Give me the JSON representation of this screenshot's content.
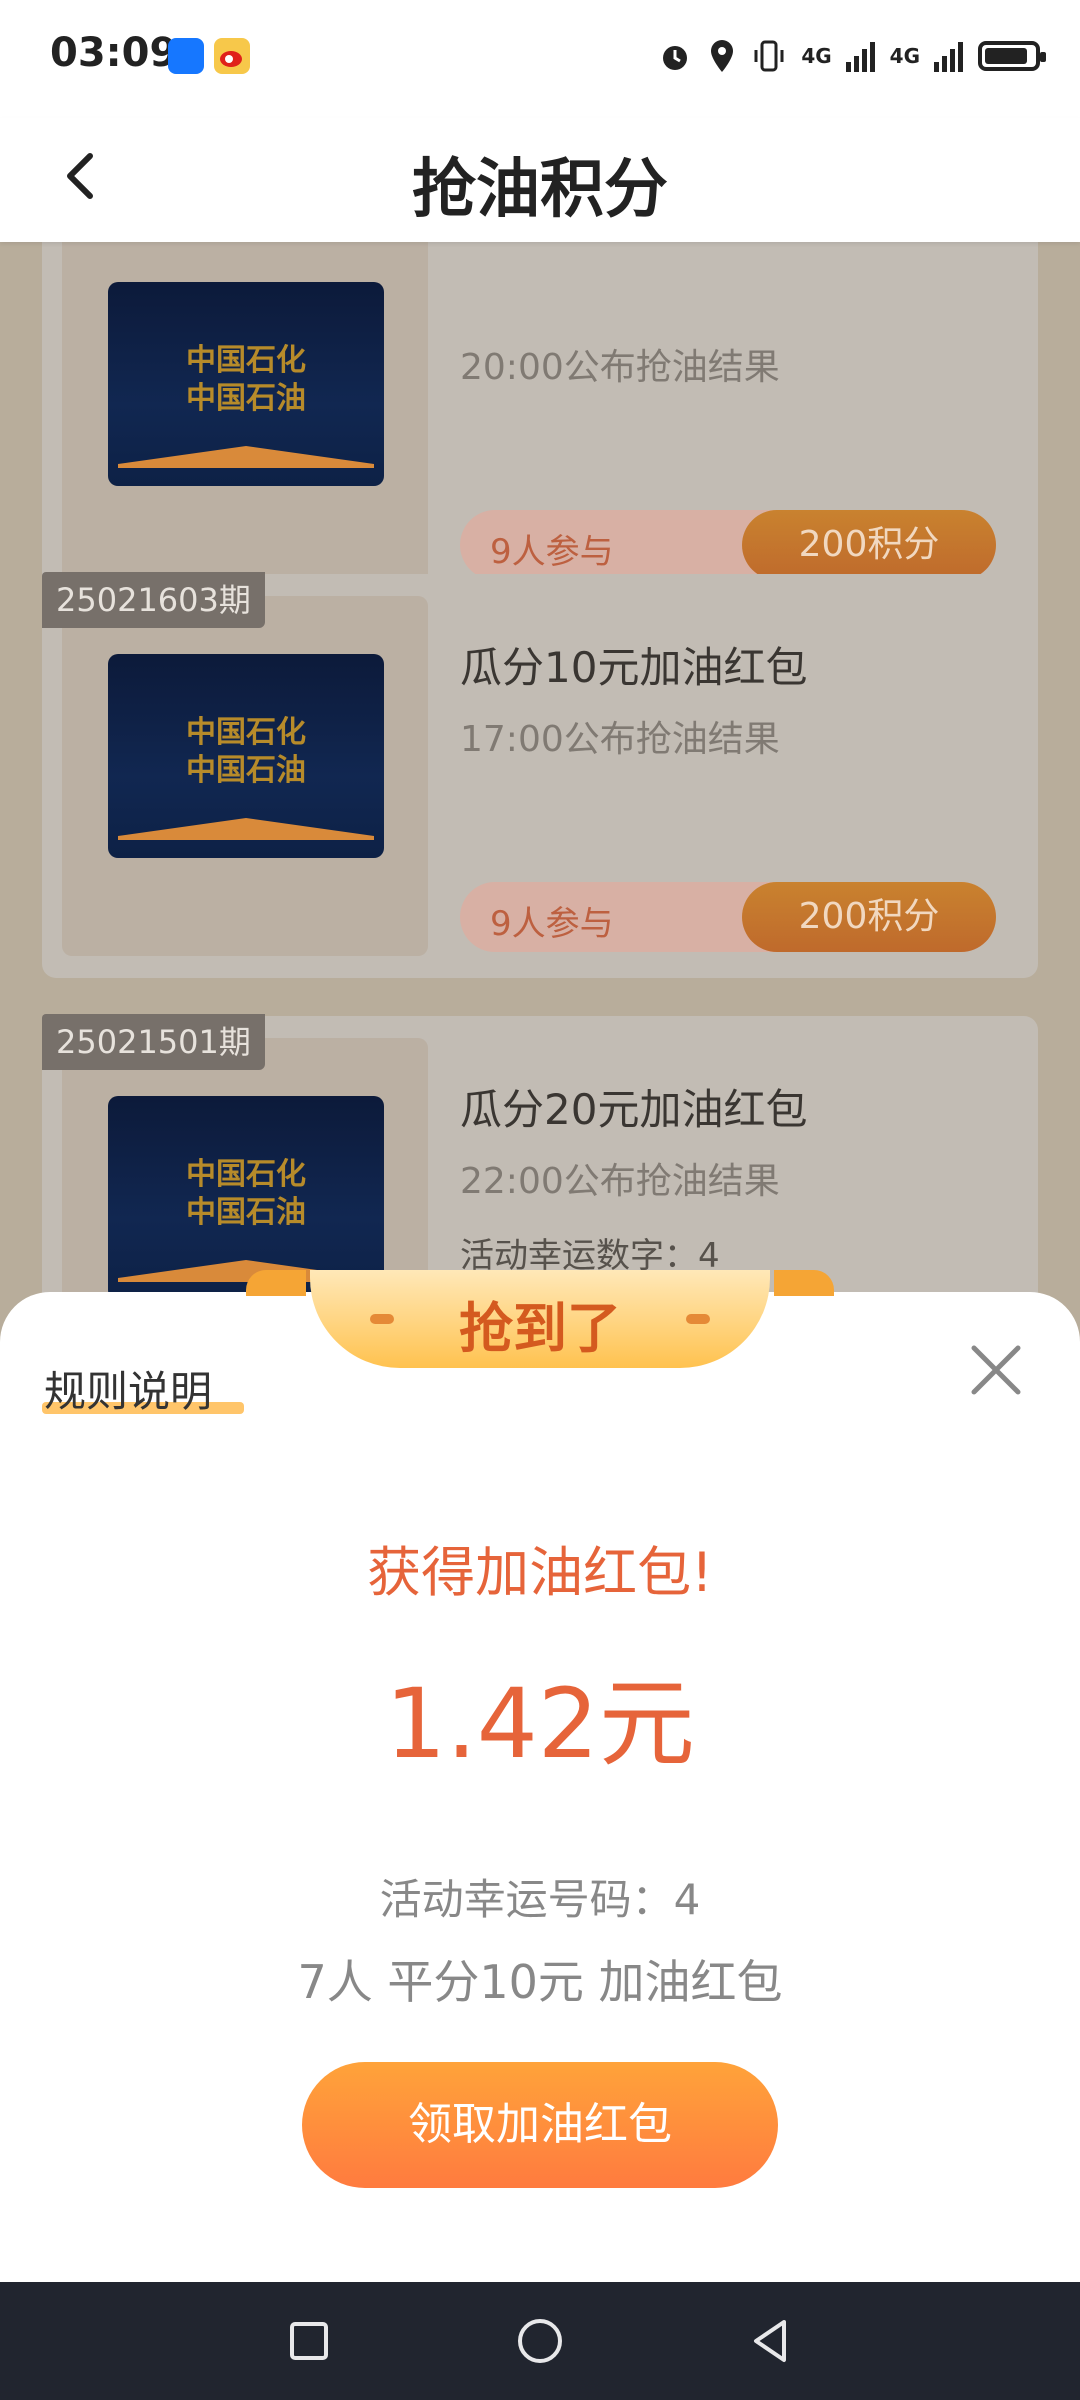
{
  "status_bar": {
    "time": "03:09",
    "signal1": "4G",
    "signal2": "4G"
  },
  "header": {
    "title": "抢油积分"
  },
  "cards": [
    {
      "period": "",
      "title": "",
      "subtitle": "20:00公布抢油结果",
      "extra": "",
      "participants": "9人参与",
      "points": "200积分",
      "image_text_line1": "中国石化",
      "image_text_line2": "中国石油"
    },
    {
      "period": "25021603期",
      "title": "瓜分10元加油红包",
      "subtitle": "17:00公布抢油结果",
      "extra": "",
      "participants": "9人参与",
      "points": "200积分",
      "image_text_line1": "中国石化",
      "image_text_line2": "中国石油"
    },
    {
      "period": "25021501期",
      "title": "瓜分20元加油红包",
      "subtitle": "22:00公布抢油结果",
      "extra": "活动幸运数字：4",
      "participants": "",
      "points": "",
      "image_text_line1": "中国石化",
      "image_text_line2": "中国石油"
    }
  ],
  "sheet": {
    "tab_label": "抢到了",
    "rules_link": "规则说明",
    "headline": "获得加油红包!",
    "amount": "1.42元",
    "lucky_number": "活动幸运号码：4",
    "split_info": "7人  平分10元  加油红包",
    "claim_button": "领取加油红包"
  },
  "icons": {
    "back": "chevron-left-icon",
    "close": "close-icon",
    "recent": "square-icon",
    "home": "circle-icon",
    "system_back": "triangle-back-icon"
  },
  "colors": {
    "accent": "#e6643a",
    "button_start": "#ffa33a",
    "button_end": "#ff7b3f"
  }
}
